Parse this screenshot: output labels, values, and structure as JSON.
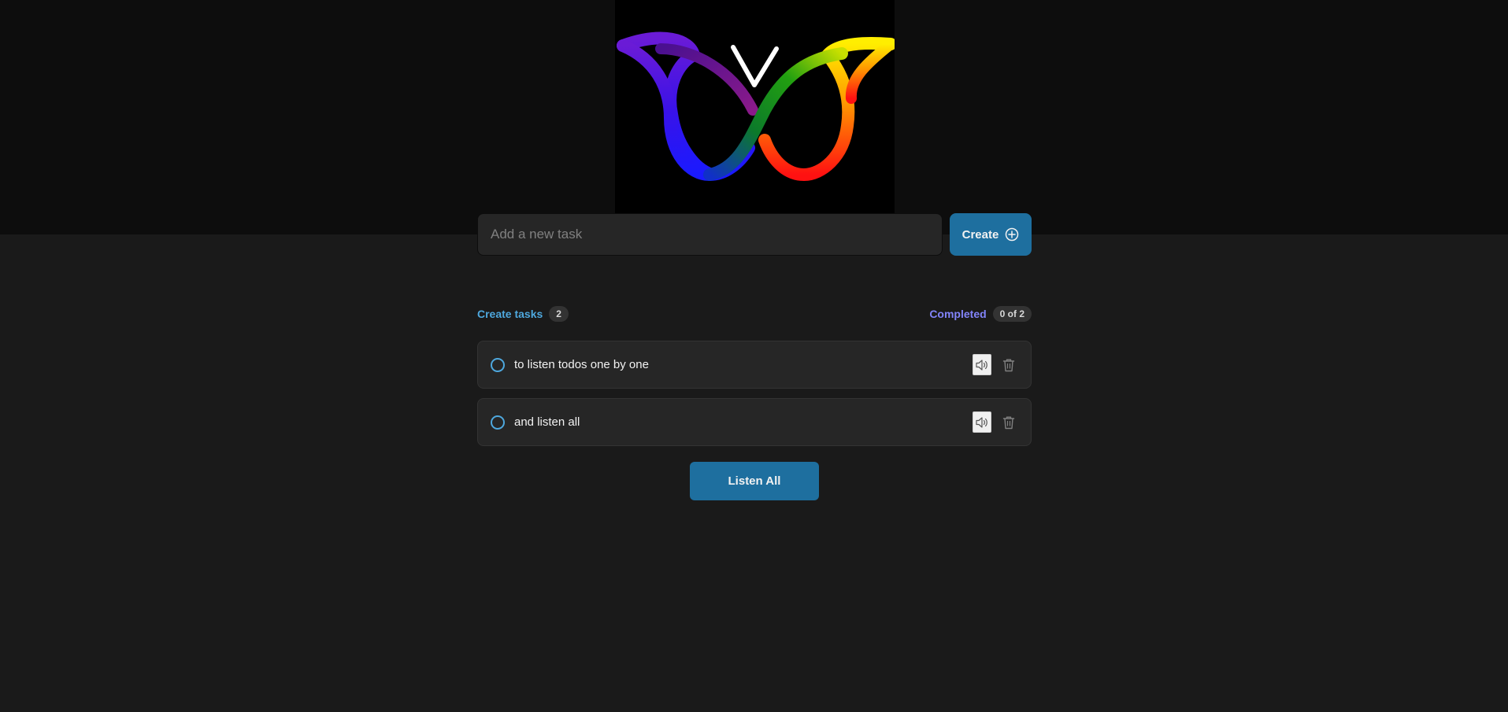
{
  "logo": {
    "icon": "rainbow-butterfly-logo"
  },
  "new_task": {
    "placeholder": "Add a new task",
    "value": "",
    "create_label": "Create",
    "create_icon": "plus-circle-icon"
  },
  "summary": {
    "created_label": "Create tasks",
    "created_count": "2",
    "completed_label": "Completed",
    "completed_count": "0 of 2"
  },
  "tasks": [
    {
      "text": "to listen todos one by one",
      "completed": false,
      "speak_icon": "speaker-icon",
      "delete_icon": "trash-icon"
    },
    {
      "text": "and listen all",
      "completed": false,
      "speak_icon": "speaker-icon",
      "delete_icon": "trash-icon"
    }
  ],
  "listen_all_label": "Listen All",
  "colors": {
    "accent_blue": "#4ea8de",
    "accent_purple": "#8284fa",
    "button_blue": "#1e6f9f",
    "background": "#1a1a1a",
    "header_background": "#0d0d0d",
    "card_background": "#262626"
  }
}
